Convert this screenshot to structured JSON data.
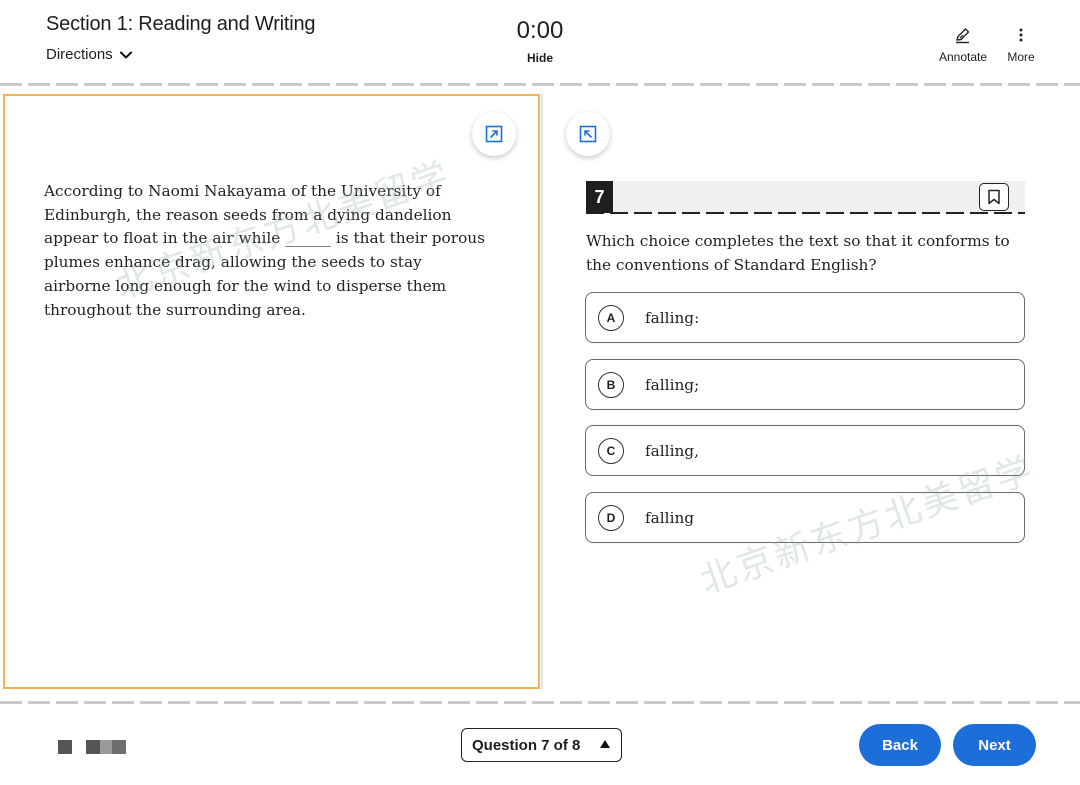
{
  "header": {
    "section_title": "Section 1: Reading and Writing",
    "directions_label": "Directions",
    "timer": "0:00",
    "hide_label": "Hide",
    "annotate_label": "Annotate",
    "more_label": "More"
  },
  "passage": {
    "text": "According to Naomi Nakayama of the University of Edinburgh, the reason seeds from a dying dandelion appear to float in the air while ______ is that their porous plumes enhance drag, allowing the seeds to stay airborne long enough for the wind to disperse them throughout the surrounding area."
  },
  "watermark": {
    "text": "北京新东方北美留学"
  },
  "question": {
    "number": "7",
    "prompt": "Which choice completes the text so that it conforms to the conventions of Standard English?",
    "choices": [
      {
        "letter": "A",
        "text": "falling:"
      },
      {
        "letter": "B",
        "text": "falling;"
      },
      {
        "letter": "C",
        "text": "falling,"
      },
      {
        "letter": "D",
        "text": "falling"
      }
    ]
  },
  "footer": {
    "question_nav_label": "Question 7 of 8",
    "back_label": "Back",
    "next_label": "Next"
  },
  "colors": {
    "accent_blue": "#1d6ed8",
    "panel_border_orange": "#f0b44c",
    "question_number_bg": "#1f1f1f"
  },
  "icons": {
    "directions": "chevron-down-icon",
    "annotate": "pen-icon",
    "more": "vertical-dots-icon",
    "expand": "expand-icon",
    "collapse": "collapse-icon",
    "bookmark": "bookmark-icon",
    "question_nav": "caret-up-icon"
  }
}
